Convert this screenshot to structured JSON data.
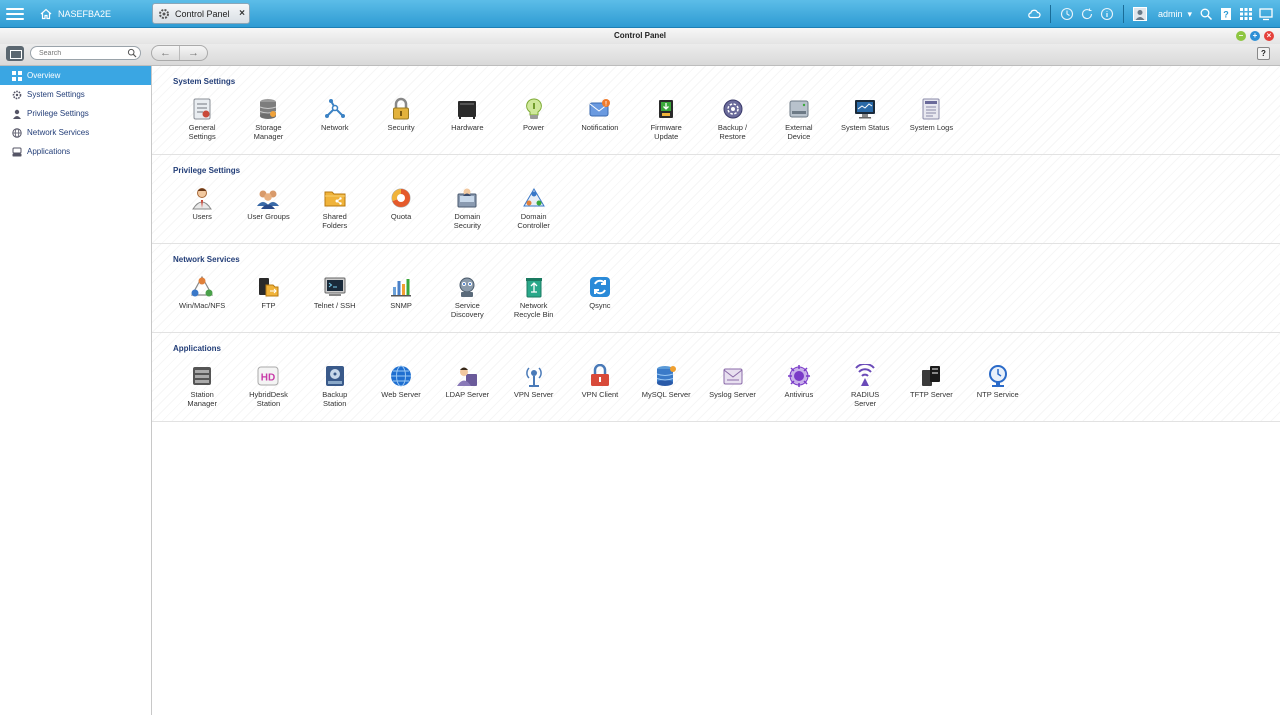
{
  "topbar": {
    "home_label": "NASEFBA2E",
    "tab_label": "Control Panel",
    "user": "admin"
  },
  "window": {
    "title": "Control Panel"
  },
  "toolbar": {
    "search_placeholder": "Search"
  },
  "sidebar": {
    "items": [
      {
        "label": "Overview",
        "icon": "grid-icon"
      },
      {
        "label": "System Settings",
        "icon": "gear-icon"
      },
      {
        "label": "Privilege Settings",
        "icon": "user-icon"
      },
      {
        "label": "Network Services",
        "icon": "globe-icon"
      },
      {
        "label": "Applications",
        "icon": "app-icon"
      }
    ]
  },
  "colors": {
    "accent": "#3aa6e3",
    "title_blue": "#233e78",
    "topbar": "#2e9bd3"
  },
  "sections": [
    {
      "title": "System Settings",
      "items": [
        {
          "label": "General\nSettings",
          "icon": "general-settings-icon",
          "color": "#8a8f96"
        },
        {
          "label": "Storage\nManager",
          "icon": "storage-manager-icon",
          "color": "#6d6d6d"
        },
        {
          "label": "Network",
          "icon": "network-icon",
          "color": "#3b82c4"
        },
        {
          "label": "Security",
          "icon": "lock-icon",
          "color": "#6b6b6b"
        },
        {
          "label": "Hardware",
          "icon": "hardware-icon",
          "color": "#2a2a2a"
        },
        {
          "label": "Power",
          "icon": "power-icon",
          "color": "#9bcc3f"
        },
        {
          "label": "Notification",
          "icon": "notification-icon",
          "color": "#4a7fd0"
        },
        {
          "label": "Firmware\nUpdate",
          "icon": "firmware-icon",
          "color": "#2f8a2f"
        },
        {
          "label": "Backup /\nRestore",
          "icon": "backup-restore-icon",
          "color": "#5c5c8a"
        },
        {
          "label": "External\nDevice",
          "icon": "external-device-icon",
          "color": "#7d8a96"
        },
        {
          "label": "System Status",
          "icon": "system-status-icon",
          "color": "#1f4f78"
        },
        {
          "label": "System Logs",
          "icon": "system-logs-icon",
          "color": "#7c7c9a"
        }
      ]
    },
    {
      "title": "Privilege Settings",
      "items": [
        {
          "label": "Users",
          "icon": "users-icon",
          "color": "#c97a3a"
        },
        {
          "label": "User Groups",
          "icon": "user-groups-icon",
          "color": "#b86a2e"
        },
        {
          "label": "Shared\nFolders",
          "icon": "shared-folders-icon",
          "color": "#f0b33a"
        },
        {
          "label": "Quota",
          "icon": "quota-icon",
          "color": "#e55a2b"
        },
        {
          "label": "Domain\nSecurity",
          "icon": "domain-security-icon",
          "color": "#5a6f8a"
        },
        {
          "label": "Domain\nController",
          "icon": "domain-controller-icon",
          "color": "#3a78c8"
        }
      ]
    },
    {
      "title": "Network Services",
      "items": [
        {
          "label": "Win/Mac/NFS",
          "icon": "win-mac-nfs-icon",
          "color": "#4aa04a"
        },
        {
          "label": "FTP",
          "icon": "ftp-icon",
          "color": "#e0a030"
        },
        {
          "label": "Telnet / SSH",
          "icon": "telnet-ssh-icon",
          "color": "#2a3a4a"
        },
        {
          "label": "SNMP",
          "icon": "snmp-icon",
          "color": "#6aa0d8"
        },
        {
          "label": "Service\nDiscovery",
          "icon": "service-discovery-icon",
          "color": "#5a6a7a"
        },
        {
          "label": "Network\nRecycle Bin",
          "icon": "recycle-bin-icon",
          "color": "#2aa88a"
        },
        {
          "label": "Qsync",
          "icon": "qsync-icon",
          "color": "#2a8ad8"
        }
      ]
    },
    {
      "title": "Applications",
      "items": [
        {
          "label": "Station\nManager",
          "icon": "station-manager-icon",
          "color": "#555555"
        },
        {
          "label": "HybridDesk\nStation",
          "icon": "hybriddesk-icon",
          "color": "#c83aa8"
        },
        {
          "label": "Backup\nStation",
          "icon": "backup-station-icon",
          "color": "#3a5a8a"
        },
        {
          "label": "Web Server",
          "icon": "web-server-icon",
          "color": "#1f6fd0"
        },
        {
          "label": "LDAP Server",
          "icon": "ldap-server-icon",
          "color": "#6a5a9a"
        },
        {
          "label": "VPN Server",
          "icon": "vpn-server-icon",
          "color": "#4a7ab8"
        },
        {
          "label": "VPN Client",
          "icon": "vpn-client-icon",
          "color": "#d84a3a"
        },
        {
          "label": "MySQL Server",
          "icon": "mysql-server-icon",
          "color": "#3a7ac8"
        },
        {
          "label": "Syslog Server",
          "icon": "syslog-server-icon",
          "color": "#8a6aa8"
        },
        {
          "label": "Antivirus",
          "icon": "antivirus-icon",
          "color": "#7a3ac8"
        },
        {
          "label": "RADIUS\nServer",
          "icon": "radius-server-icon",
          "color": "#6a4ab8"
        },
        {
          "label": "TFTP Server",
          "icon": "tftp-server-icon",
          "color": "#3a3a3a"
        },
        {
          "label": "NTP Service",
          "icon": "ntp-service-icon",
          "color": "#2a6ac8"
        }
      ]
    }
  ]
}
